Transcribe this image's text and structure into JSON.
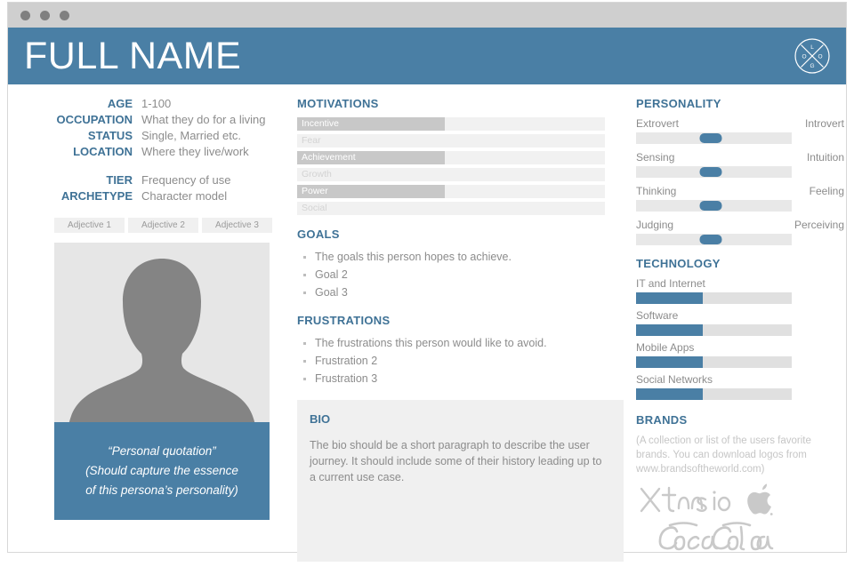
{
  "window": {
    "dots": [
      "close-dot",
      "minimize-dot",
      "maximize-dot"
    ]
  },
  "header": {
    "name": "FULL NAME",
    "logo_letters": [
      "L",
      "O",
      "G",
      "O"
    ],
    "accent_color": "#4a7fa5"
  },
  "attributes": [
    {
      "label": "AGE",
      "value": "1-100"
    },
    {
      "label": "OCCUPATION",
      "value": "What they do for a living"
    },
    {
      "label": "STATUS",
      "value": "Single, Married etc."
    },
    {
      "label": "LOCATION",
      "value": "Where they live/work"
    },
    {
      "label": "TIER",
      "value": "Frequency of use"
    },
    {
      "label": "ARCHETYPE",
      "value": "Character model"
    }
  ],
  "adjectives": [
    "Adjective 1",
    "Adjective 2",
    "Adjective 3"
  ],
  "quote": {
    "line1": "“Personal quotation”",
    "line2": "(Should capture the essence",
    "line3": "of this persona’s personality)"
  },
  "motivations": {
    "heading": "MOTIVATIONS",
    "items": [
      {
        "label": "Incentive",
        "fill_percent": 48
      },
      {
        "label": "Fear",
        "fill_percent": 0
      },
      {
        "label": "Achievement",
        "fill_percent": 48
      },
      {
        "label": "Growth",
        "fill_percent": 0
      },
      {
        "label": "Power",
        "fill_percent": 48
      },
      {
        "label": "Social",
        "fill_percent": 0
      }
    ]
  },
  "goals": {
    "heading": "GOALS",
    "items": [
      "The goals this person hopes to achieve.",
      "Goal 2",
      "Goal 3"
    ]
  },
  "frustrations": {
    "heading": "FRUSTRATIONS",
    "items": [
      "The frustrations this person would like to avoid.",
      "Frustration 2",
      "Frustration 3"
    ]
  },
  "bio": {
    "heading": "BIO",
    "text": "The bio should be a short paragraph to describe the user journey. It should include some of their history leading up to a current use case."
  },
  "personality": {
    "heading": "PERSONALITY",
    "items": [
      {
        "left": "Extrovert",
        "right": "Introvert",
        "value_percent": 48
      },
      {
        "left": "Sensing",
        "right": "Intuition",
        "value_percent": 48
      },
      {
        "left": "Thinking",
        "right": "Feeling",
        "value_percent": 48
      },
      {
        "left": "Judging",
        "right": "Perceiving",
        "value_percent": 48
      }
    ]
  },
  "technology": {
    "heading": "TECHNOLOGY",
    "items": [
      {
        "label": "IT and Internet",
        "fill_percent": 43
      },
      {
        "label": "Software",
        "fill_percent": 43
      },
      {
        "label": "Mobile Apps",
        "fill_percent": 43
      },
      {
        "label": "Social Networks",
        "fill_percent": 43
      }
    ]
  },
  "brands": {
    "heading": "BRANDS",
    "note": "(A collection or list of the users favorite brands. You can download logos from www.brandsoftheworld.com)",
    "logos": [
      "Xtensio",
      "Apple",
      "Coca-Cola"
    ]
  }
}
